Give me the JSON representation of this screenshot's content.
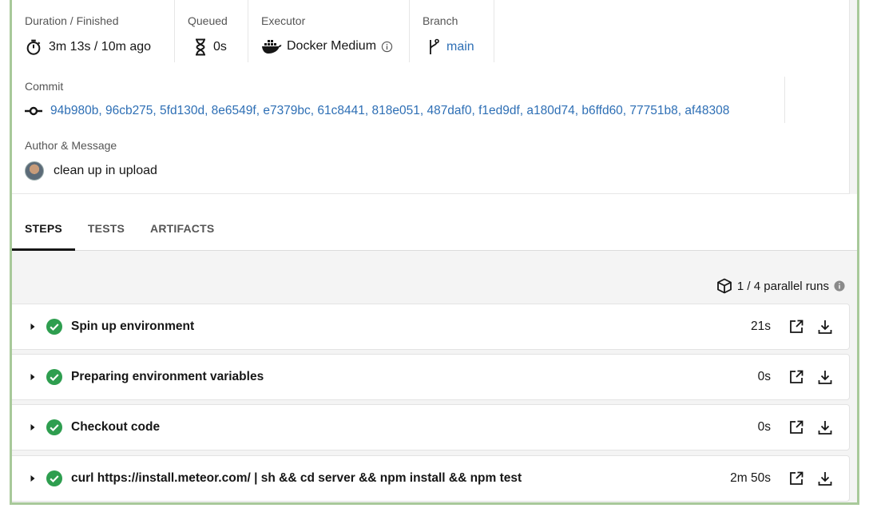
{
  "meta": {
    "duration": {
      "label": "Duration / Finished",
      "value": "3m 13s / 10m ago",
      "icon": "stopwatch-icon"
    },
    "queued": {
      "label": "Queued",
      "value": "0s",
      "icon": "hourglass-icon"
    },
    "executor": {
      "label": "Executor",
      "value": "Docker Medium",
      "icon": "docker-icon"
    },
    "branch": {
      "label": "Branch",
      "value": "main",
      "icon": "branch-icon"
    }
  },
  "commit": {
    "label": "Commit",
    "hashes": "94b980b, 96cb275, 5fd130d, 8e6549f, e7379bc, 61c8441, 818e051, 487daf0, f1ed9df, a180d74, b6ffd60, 77751b8, af48308"
  },
  "author": {
    "label": "Author & Message",
    "message": "clean up in upload"
  },
  "tabs": [
    {
      "label": "STEPS",
      "active": true
    },
    {
      "label": "TESTS",
      "active": false
    },
    {
      "label": "ARTIFACTS",
      "active": false
    }
  ],
  "parallel": {
    "text": "1 / 4 parallel runs"
  },
  "steps": [
    {
      "name": "Spin up environment",
      "duration": "21s"
    },
    {
      "name": "Preparing environment variables",
      "duration": "0s"
    },
    {
      "name": "Checkout code",
      "duration": "0s"
    },
    {
      "name": "curl https://install.meteor.com/ | sh && cd server && npm install && npm test",
      "duration": "2m 50s"
    }
  ],
  "colors": {
    "success": "#2e9e4f",
    "link": "#2e6fb5",
    "frame": "#a8c99a"
  }
}
